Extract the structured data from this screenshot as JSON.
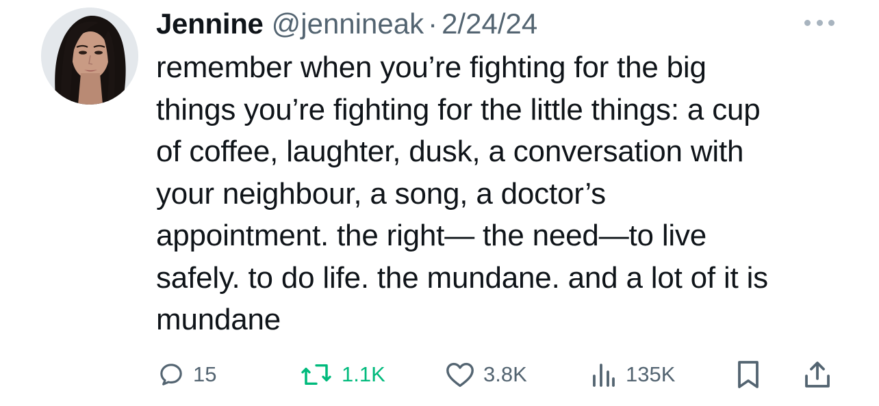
{
  "tweet": {
    "author": {
      "display_name": "Jennine",
      "handle": "@jennineak",
      "separator": "·",
      "date": "2/24/24"
    },
    "body_lines": [
      "remember when you’re fighting for the big",
      "things you’re fighting for the little things: a cup",
      "of coffee, laughter, dusk, a conversation with",
      "your neighbour, a song, a doctor’s",
      "appointment. the right— the need—to live",
      "safely. to do life. the mundane. and a lot of it is",
      "mundane"
    ],
    "stats": {
      "replies": "15",
      "retweets": "1.1K",
      "likes": "3.8K",
      "views": "135K"
    }
  },
  "icons": {
    "avatar": "profile-photo",
    "more": "more-horizontal-icon",
    "reply": "reply-icon",
    "retweet": "retweet-icon",
    "like": "heart-icon",
    "views": "views-chart-icon",
    "bookmark": "bookmark-icon",
    "share": "share-icon"
  },
  "colors": {
    "text_primary": "#0f1419",
    "text_secondary": "#536471",
    "retweet_green": "#00ba7c",
    "more_dots": "#a8b4bf"
  }
}
